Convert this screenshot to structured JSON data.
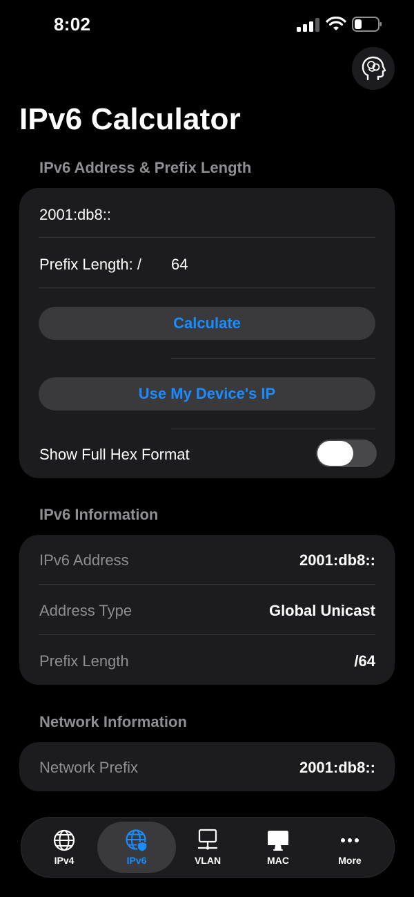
{
  "status_bar": {
    "time": "8:02"
  },
  "header": {
    "title": "IPv6 Calculator"
  },
  "input_section": {
    "header": "IPv6 Address & Prefix Length",
    "address_value": "2001:db8::",
    "prefix_label": "Prefix Length: /",
    "prefix_value": "64",
    "calculate_label": "Calculate",
    "use_device_ip_label": "Use My Device's IP",
    "show_full_hex_label": "Show Full Hex Format",
    "show_full_hex_on": false
  },
  "ipv6_info": {
    "header": "IPv6 Information",
    "rows": [
      {
        "label": "IPv6 Address",
        "value": "2001:db8::"
      },
      {
        "label": "Address Type",
        "value": "Global Unicast"
      },
      {
        "label": "Prefix Length",
        "value": "/64"
      }
    ]
  },
  "network_info": {
    "header": "Network Information",
    "rows": [
      {
        "label": "Network Prefix",
        "value": "2001:db8::"
      }
    ]
  },
  "tabbar": {
    "tabs": [
      {
        "label": "IPv4",
        "icon": "globe-icon"
      },
      {
        "label": "IPv6",
        "icon": "globe-shield-icon",
        "active": true
      },
      {
        "label": "VLAN",
        "icon": "network-icon"
      },
      {
        "label": "MAC",
        "icon": "desktop-icon"
      },
      {
        "label": "More",
        "icon": "ellipsis-icon"
      }
    ]
  },
  "colors": {
    "background": "#000000",
    "card": "#1c1c1e",
    "accent": "#1a8cff",
    "secondary_text": "#8e8e93"
  }
}
